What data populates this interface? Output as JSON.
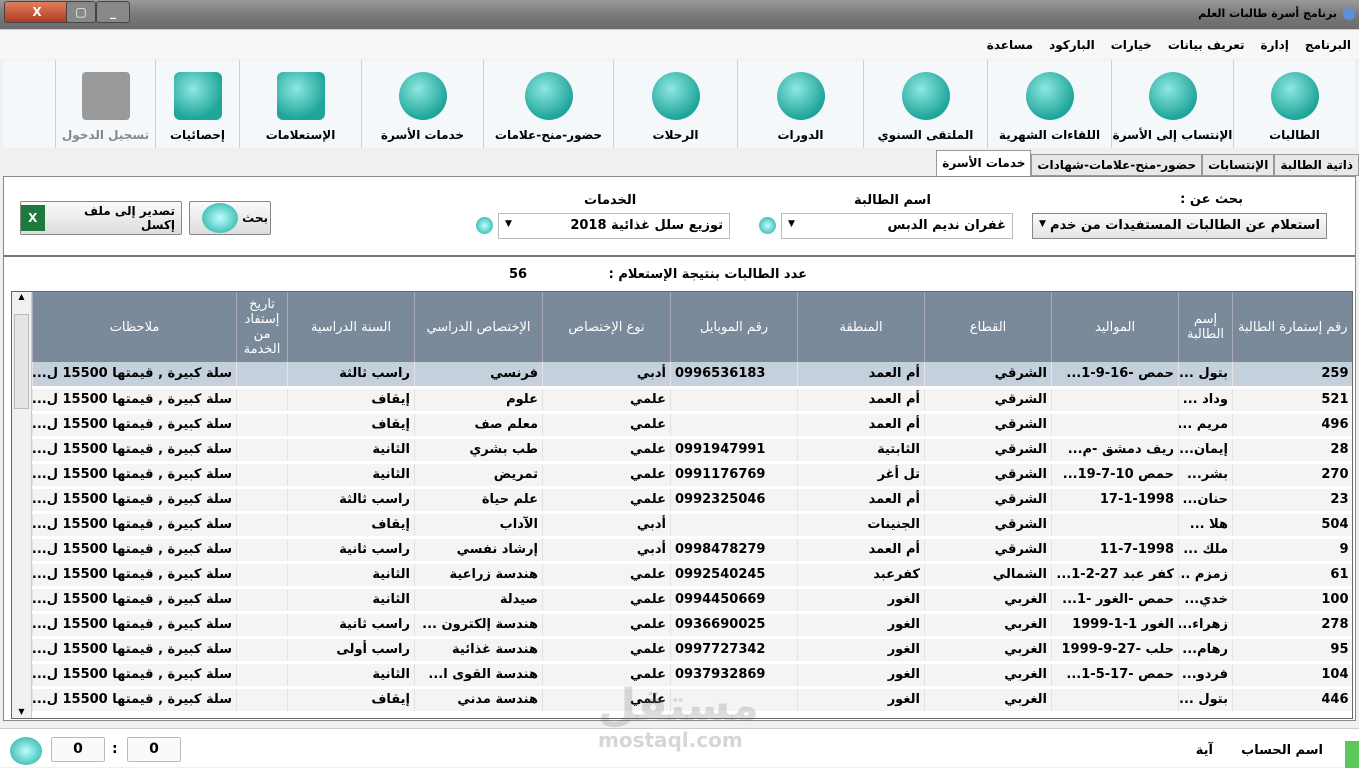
{
  "window": {
    "title": "برنامج أسرة طالبات العلم",
    "close": "X",
    "restore": "▢",
    "minimize": "_"
  },
  "menu": [
    "البرنامج",
    "إدارة",
    "تعريف بيانات",
    "خيارات",
    "الباركود",
    "مساعدة"
  ],
  "toolbar": [
    {
      "label": "الطالبات",
      "w": 122
    },
    {
      "label": "الإنتساب إلى الأسرة",
      "w": 122
    },
    {
      "label": "اللقاءات الشهرية",
      "w": 124
    },
    {
      "label": "الملتقى السنوي",
      "w": 124
    },
    {
      "label": "الدورات",
      "w": 126
    },
    {
      "label": "الرحلات",
      "w": 124
    },
    {
      "label": "حضور-منح-علامات",
      "w": 130
    },
    {
      "label": "خدمات الأسرة",
      "w": 122
    },
    {
      "label": "الإستعلامات",
      "w": 122
    },
    {
      "label": "إحصائيات",
      "w": 84
    },
    {
      "label": "تسجيل الدخول",
      "w": 100
    }
  ],
  "tabs": [
    "ذاتية الطالبة",
    "الإنتسابات",
    "حضور-منح-علامات-شهادات",
    "خدمات الأسرة"
  ],
  "search": {
    "search_for_label": "بحث عن :",
    "search_for_value": "استعلام عن الطالبات المستفيدات من خدم",
    "student_label": "اسم الطالبة",
    "student_value": "غفران نديم الدبس",
    "services_label": "الخدمات",
    "services_value": "توزيع سلل غذائية 2018",
    "search_button": "بحث",
    "export_button": "تصدير إلى ملف إكسل"
  },
  "result_count": {
    "label": "عدد الطالبات بنتيجة الإستعلام :",
    "value": "56"
  },
  "table": {
    "columns": [
      "رقم إستمارة الطالبة",
      "إسم الطالبة",
      "المواليد",
      "القطاع",
      "المنطقة",
      "رقم الموبايل",
      "نوع الإختصاص",
      "الإختصاص الدراسي",
      "السنة الدراسية",
      "تاريخ إستفاد من الخدمة",
      "ملاحظات"
    ],
    "rows": [
      [
        "259",
        "بتول ...",
        "حمص -16-9-1...",
        "الشرقي",
        "أم العمد",
        "0996536183",
        "أدبي",
        "فرنسي",
        "راسب ثالثة",
        "",
        "سلة كبيرة , قيمتها 15500 ل..."
      ],
      [
        "521",
        "وداد ...",
        "",
        "الشرقي",
        "أم العمد",
        "",
        "علمي",
        "علوم",
        "إيقاف",
        "",
        "سلة كبيرة , قيمتها 15500 ل..."
      ],
      [
        "496",
        "مريم ...",
        "",
        "الشرقي",
        "أم العمد",
        "",
        "علمي",
        "معلم صف",
        "إيقاف",
        "",
        "سلة كبيرة , قيمتها 15500 ل..."
      ],
      [
        "28",
        "إيمان...",
        "ريف دمشق -م...",
        "الشرقي",
        "الثابتية",
        "0991947991",
        "علمي",
        "طب بشري",
        "الثانية",
        "",
        "سلة كبيرة , قيمتها 15500 ل..."
      ],
      [
        "270",
        "بشر...",
        "حمص 10-7-19...",
        "الشرقي",
        "تل أغر",
        "0991176769",
        "علمي",
        "تمريض",
        "الثانية",
        "",
        "سلة كبيرة , قيمتها 15500 ل..."
      ],
      [
        "23",
        "حنان...",
        "17-1-1998",
        "الشرقي",
        "أم العمد",
        "0992325046",
        "علمي",
        "علم حياة",
        "راسب ثالثة",
        "",
        "سلة كبيرة , قيمتها 15500 ل..."
      ],
      [
        "504",
        "هلا ...",
        "",
        "الشرقي",
        "الجنينات",
        "",
        "أدبي",
        "الآداب",
        "إيقاف",
        "",
        "سلة كبيرة , قيمتها 15500 ل..."
      ],
      [
        "9",
        "ملك ...",
        "11-7-1998",
        "الشرقي",
        "أم العمد",
        "0998478279",
        "أدبي",
        "إرشاد نفسي",
        "راسب ثانية",
        "",
        "سلة كبيرة , قيمتها 15500 ل..."
      ],
      [
        "61",
        "زمزم ...",
        "كفر عبد 27-2-1...",
        "الشمالي",
        "كفرعبد",
        "0992540245",
        "علمي",
        "هندسة زراعية",
        "الثانية",
        "",
        "سلة كبيرة , قيمتها 15500 ل..."
      ],
      [
        "100",
        "خدي...",
        "حمص -الغور -1...",
        "الغربي",
        "الغور",
        "0994450669",
        "علمي",
        "صيدلة",
        "الثانية",
        "",
        "سلة كبيرة , قيمتها 15500 ل..."
      ],
      [
        "278",
        "زهراء...",
        "الغور 1-1-1999",
        "الغربي",
        "الغور",
        "0936690025",
        "علمي",
        "هندسة إلكترون ...",
        "راسب ثانية",
        "",
        "سلة كبيرة , قيمتها 15500 ل..."
      ],
      [
        "95",
        "رهام...",
        "حلب -27-9-1999",
        "الغربي",
        "الغور",
        "0997727342",
        "علمي",
        "هندسة غذائية",
        "راسب أولى",
        "",
        "سلة كبيرة , قيمتها 15500 ل..."
      ],
      [
        "104",
        "فردو...",
        "حمص -17-5-1...",
        "الغربي",
        "الغور",
        "0937932869",
        "علمي",
        "هندسة القوى ا...",
        "الثانية",
        "",
        "سلة كبيرة , قيمتها 15500 ل..."
      ],
      [
        "446",
        "بتول ...",
        "",
        "الغربي",
        "الغور",
        "",
        "علمي",
        "هندسة مدني",
        "إيقاف",
        "",
        "سلة كبيرة , قيمتها 15500 ل..."
      ]
    ]
  },
  "status": {
    "account_label": "اسم الحساب",
    "account_value": "آية",
    "counter_a": "0",
    "sep": ":",
    "counter_b": "0"
  },
  "watermark": {
    "text": "مستقل",
    "url_text": "mostaql.com"
  }
}
